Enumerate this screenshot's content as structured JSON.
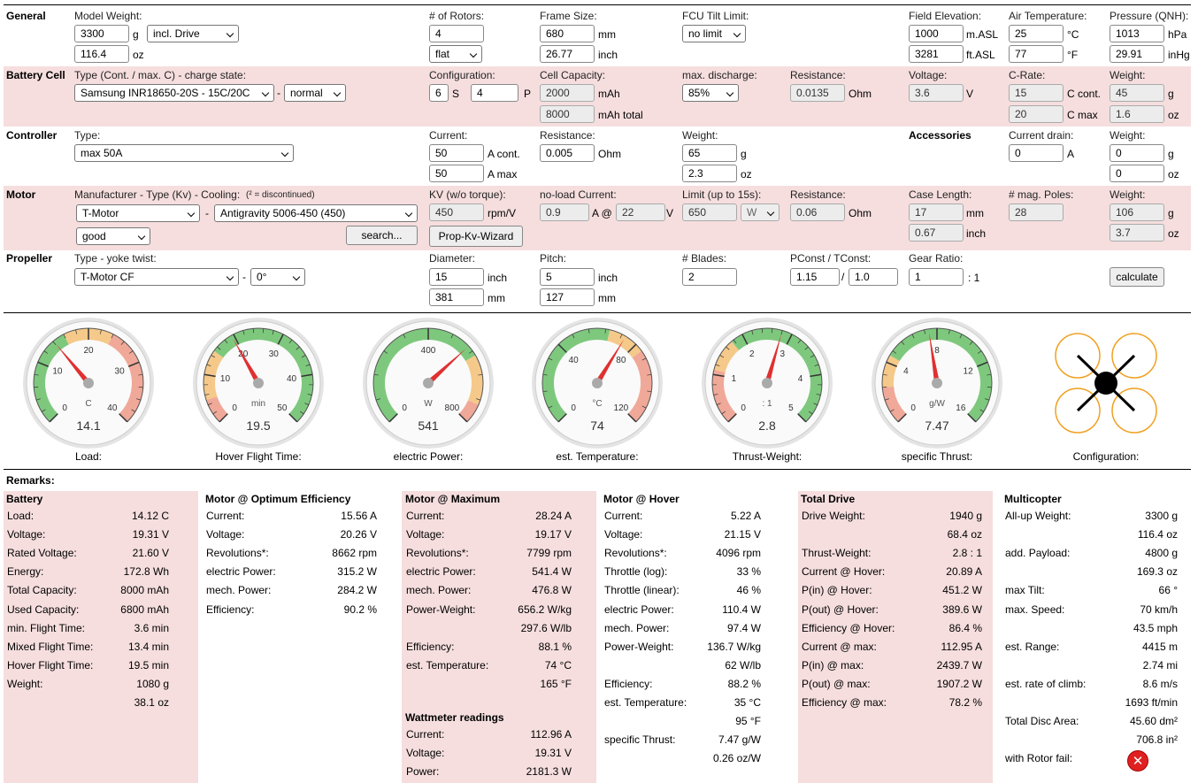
{
  "general": {
    "title": "General",
    "model_weight_label": "Model Weight:",
    "model_weight": "3300",
    "model_weight_unit": "g",
    "drive_option": "incl. Drive",
    "model_weight_oz": "116.4",
    "oz_unit": "oz",
    "rotors_label": "# of Rotors:",
    "rotors": "4",
    "rotor_layout": "flat",
    "frame_label": "Frame Size:",
    "frame_mm": "680",
    "frame_mm_unit": "mm",
    "frame_inch": "26.77",
    "frame_inch_unit": "inch",
    "fcu_label": "FCU Tilt Limit:",
    "fcu_value": "no limit",
    "elev_label": "Field Elevation:",
    "elev_m": "1000",
    "elev_m_unit": "m.ASL",
    "elev_ft": "3281",
    "elev_ft_unit": "ft.ASL",
    "air_label": "Air Temperature:",
    "air_c": "25",
    "air_c_unit": "°C",
    "air_f": "77",
    "air_f_unit": "°F",
    "pressure_label": "Pressure (QNH):",
    "pressure_hpa": "1013",
    "pressure_hpa_unit": "hPa",
    "pressure_inhg": "29.91",
    "pressure_inhg_unit": "inHg"
  },
  "battery": {
    "title": "Battery Cell",
    "type_label": "Type (Cont. / max. C) - charge state:",
    "type_value": "Samsung INR18650-20S - 15C/20C",
    "dash": "-",
    "state_value": "normal",
    "config_label": "Configuration:",
    "s_value": "6",
    "s_unit": "S",
    "p_value": "4",
    "p_unit": "P",
    "cap_label": "Cell Capacity:",
    "cap_value": "2000",
    "cap_unit": "mAh",
    "cap_total": "8000",
    "cap_total_unit": "mAh total",
    "discharge_label": "max. discharge:",
    "discharge_value": "85%",
    "res_label": "Resistance:",
    "res_value": "0.0135",
    "res_unit": "Ohm",
    "volt_label": "Voltage:",
    "volt_value": "3.6",
    "volt_unit": "V",
    "crate_label": "C-Rate:",
    "crate_cont": "15",
    "crate_cont_unit": "C cont.",
    "crate_max": "20",
    "crate_max_unit": "C max",
    "weight_label": "Weight:",
    "weight_g": "45",
    "weight_g_unit": "g",
    "weight_oz": "1.6",
    "weight_oz_unit": "oz"
  },
  "controller": {
    "title": "Controller",
    "type_label": "Type:",
    "type_value": "max 50A",
    "current_label": "Current:",
    "cur_cont": "50",
    "cur_cont_unit": "A cont.",
    "cur_max": "50",
    "cur_max_unit": "A max",
    "res_label": "Resistance:",
    "res_value": "0.005",
    "res_unit": "Ohm",
    "weight_label": "Weight:",
    "weight_g": "65",
    "weight_g_unit": "g",
    "weight_oz": "2.3",
    "weight_oz_unit": "oz",
    "acc_title": "Accessories",
    "drain_label": "Current drain:",
    "drain_value": "0",
    "drain_unit": "A",
    "acc_weight_label": "Weight:",
    "acc_weight_g": "0",
    "acc_weight_g_unit": "g",
    "acc_weight_oz": "0",
    "acc_weight_oz_unit": "oz"
  },
  "motor": {
    "title": "Motor",
    "type_label": "Manufacturer - Type (Kv) - Cooling:",
    "type_note": "(² = discontinued)",
    "manufacturer": "T-Motor",
    "dash": "-",
    "model": "Antigravity 5006-450 (450)",
    "cooling": "good",
    "search": "search...",
    "kv_label": "KV (w/o torque):",
    "kv_value": "450",
    "kv_unit": "rpm/V",
    "wizard": "Prop-Kv-Wizard",
    "noload_label": "no-load Current:",
    "noload_a": "0.9",
    "noload_at": "A @",
    "noload_v": "22",
    "noload_v_unit": "V",
    "limit_label": "Limit (up to 15s):",
    "limit_value": "650",
    "limit_unit": "W",
    "res_label": "Resistance:",
    "res_value": "0.06",
    "res_unit": "Ohm",
    "case_label": "Case Length:",
    "case_mm": "17",
    "case_mm_unit": "mm",
    "case_inch": "0.67",
    "case_inch_unit": "inch",
    "poles_label": "# mag. Poles:",
    "poles_value": "28",
    "weight_label": "Weight:",
    "weight_g": "106",
    "weight_g_unit": "g",
    "weight_oz": "3.7",
    "weight_oz_unit": "oz"
  },
  "propeller": {
    "title": "Propeller",
    "type_label": "Type - yoke twist:",
    "type_value": "T-Motor CF",
    "dash": "-",
    "twist": "0°",
    "dia_label": "Diameter:",
    "dia_inch": "15",
    "dia_inch_unit": "inch",
    "dia_mm": "381",
    "dia_mm_unit": "mm",
    "pitch_label": "Pitch:",
    "pitch_inch": "5",
    "pitch_inch_unit": "inch",
    "pitch_mm": "127",
    "pitch_mm_unit": "mm",
    "blades_label": "# Blades:",
    "blades": "2",
    "pconst_label": "PConst / TConst:",
    "pconst": "1.15",
    "slash": "/",
    "tconst": "1.0",
    "gear_label": "Gear Ratio:",
    "gear": "1",
    "gear_unit": ": 1",
    "calculate": "calculate"
  },
  "gauges": [
    {
      "label": "Load:",
      "value": "14.1",
      "unit": "C",
      "level": 14.1,
      "min": 0,
      "max": 40,
      "ticks": [
        "0",
        "10",
        "20",
        "30",
        "40"
      ],
      "zones": [
        [
          "#7ec87e",
          0,
          0.4
        ],
        [
          "#f5c98a",
          0.4,
          0.6
        ],
        [
          "#f0a898",
          0.6,
          1
        ]
      ]
    },
    {
      "label": "Hover Flight Time:",
      "value": "19.5",
      "unit": "min",
      "level": 19.5,
      "min": 0,
      "max": 50,
      "ticks": [
        "0",
        "10",
        "20",
        "30",
        "40",
        "50"
      ],
      "zones": [
        [
          "#f0a898",
          0,
          0.1
        ],
        [
          "#f5c98a",
          0.1,
          0.3
        ],
        [
          "#7ec87e",
          0.3,
          1
        ]
      ]
    },
    {
      "label": "electric Power:",
      "value": "541",
      "unit": "W",
      "level": 541,
      "min": 0,
      "max": 800,
      "ticks": [
        "0",
        "400",
        "800"
      ],
      "zones": [
        [
          "#7ec87e",
          0,
          0.72
        ],
        [
          "#f5c98a",
          0.72,
          0.92
        ],
        [
          "#f0a898",
          0.92,
          1
        ]
      ]
    },
    {
      "label": "est. Temperature:",
      "value": "74",
      "unit": "°C",
      "level": 74,
      "min": 0,
      "max": 120,
      "ticks": [
        "0",
        "40",
        "80",
        "120"
      ],
      "zones": [
        [
          "#7ec87e",
          0,
          0.55
        ],
        [
          "#f5c98a",
          0.55,
          0.7
        ],
        [
          "#f0a898",
          0.7,
          1
        ]
      ]
    },
    {
      "label": "Thrust-Weight:",
      "value": "2.8",
      "unit": ": 1",
      "level": 2.8,
      "min": 0,
      "max": 5,
      "ticks": [
        "0",
        "1",
        "2",
        "3",
        "4",
        "5"
      ],
      "zones": [
        [
          "#f0a898",
          0,
          0.22
        ],
        [
          "#f5c98a",
          0.22,
          0.35
        ],
        [
          "#7ec87e",
          0.35,
          1
        ]
      ]
    },
    {
      "label": "specific Thrust:",
      "value": "7.47",
      "unit": "g/W",
      "level": 7.47,
      "min": 0,
      "max": 16,
      "ticks": [
        "0",
        "4",
        "8",
        "12",
        "16"
      ],
      "zones": [
        [
          "#f0a898",
          0,
          0.15
        ],
        [
          "#f5c98a",
          0.15,
          0.28
        ],
        [
          "#7ec87e",
          0.28,
          1
        ]
      ]
    }
  ],
  "configuration_label": "Configuration:",
  "remarks": {
    "title": "Remarks:",
    "battery": {
      "title": "Battery",
      "rows": [
        [
          "Load:",
          "14.12 C"
        ],
        [
          "Voltage:",
          "19.31 V"
        ],
        [
          "Rated Voltage:",
          "21.60 V"
        ],
        [
          "Energy:",
          "172.8 Wh"
        ],
        [
          "Total Capacity:",
          "8000 mAh"
        ],
        [
          "Used Capacity:",
          "6800 mAh"
        ],
        [
          "min. Flight Time:",
          "3.6 min"
        ],
        [
          "Mixed Flight Time:",
          "13.4 min"
        ],
        [
          "Hover Flight Time:",
          "19.5 min"
        ],
        [
          "Weight:",
          "1080 g"
        ],
        [
          "",
          "38.1 oz"
        ]
      ]
    },
    "optimum": {
      "title": "Motor @ Optimum Efficiency",
      "rows": [
        [
          "Current:",
          "15.56 A"
        ],
        [
          "Voltage:",
          "20.26 V"
        ],
        [
          "Revolutions*:",
          "8662 rpm"
        ],
        [
          "electric Power:",
          "315.2 W"
        ],
        [
          "mech. Power:",
          "284.2 W"
        ],
        [
          "Efficiency:",
          "90.2 %"
        ]
      ]
    },
    "maximum": {
      "title": "Motor @ Maximum",
      "rows": [
        [
          "Current:",
          "28.24 A"
        ],
        [
          "Voltage:",
          "19.17 V"
        ],
        [
          "Revolutions*:",
          "7799 rpm"
        ],
        [
          "electric Power:",
          "541.4 W"
        ],
        [
          "mech. Power:",
          "476.8 W"
        ],
        [
          "Power-Weight:",
          "656.2 W/kg"
        ],
        [
          "",
          "297.6 W/lb"
        ],
        [
          "Efficiency:",
          "88.1 %"
        ],
        [
          "est. Temperature:",
          "74 °C"
        ],
        [
          "",
          "165 °F"
        ]
      ]
    },
    "wattmeter": {
      "title": "Wattmeter readings",
      "rows": [
        [
          "Current:",
          "112.96 A"
        ],
        [
          "Voltage:",
          "19.31 V"
        ],
        [
          "Power:",
          "2181.3 W"
        ]
      ]
    },
    "hover": {
      "title": "Motor @ Hover",
      "rows": [
        [
          "Current:",
          "5.22 A"
        ],
        [
          "Voltage:",
          "21.15 V"
        ],
        [
          "Revolutions*:",
          "4096 rpm"
        ],
        [
          "Throttle (log):",
          "33 %"
        ],
        [
          "Throttle (linear):",
          "46 %"
        ],
        [
          "electric Power:",
          "110.4 W"
        ],
        [
          "mech. Power:",
          "97.4 W"
        ],
        [
          "Power-Weight:",
          "136.7 W/kg"
        ],
        [
          "",
          "62 W/lb"
        ],
        [
          "Efficiency:",
          "88.2 %"
        ],
        [
          "est. Temperature:",
          "35 °C"
        ],
        [
          "",
          "95 °F"
        ],
        [
          "specific Thrust:",
          "7.47 g/W"
        ],
        [
          "",
          "0.26 oz/W"
        ]
      ]
    },
    "drive": {
      "title": "Total Drive",
      "rows": [
        [
          "Drive Weight:",
          "1940 g"
        ],
        [
          "",
          "68.4 oz"
        ],
        [
          "Thrust-Weight:",
          "2.8 : 1"
        ],
        [
          "Current @ Hover:",
          "20.89 A"
        ],
        [
          "P(in) @ Hover:",
          "451.2 W"
        ],
        [
          "P(out) @ Hover:",
          "389.6 W"
        ],
        [
          "Efficiency @ Hover:",
          "86.4 %"
        ],
        [
          "Current @ max:",
          "112.95 A"
        ],
        [
          "P(in) @ max:",
          "2439.7 W"
        ],
        [
          "P(out) @ max:",
          "1907.2 W"
        ],
        [
          "Efficiency @ max:",
          "78.2 %"
        ]
      ]
    },
    "multicopter": {
      "title": "Multicopter",
      "rows": [
        [
          "All-up Weight:",
          "3300 g"
        ],
        [
          "",
          "116.4 oz"
        ],
        [
          "add. Payload:",
          "4800 g"
        ],
        [
          "",
          "169.3 oz"
        ],
        [
          "max Tilt:",
          "66 °"
        ],
        [
          "max. Speed:",
          "70 km/h"
        ],
        [
          "",
          "43.5 mph"
        ],
        [
          "est. Range:",
          "4415 m"
        ],
        [
          "",
          "2.74 mi"
        ],
        [
          "est. rate of climb:",
          "8.6 m/s"
        ],
        [
          "",
          "1693 ft/min"
        ],
        [
          "Total Disc Area:",
          "45.60 dm²"
        ],
        [
          "",
          "706.8 in²"
        ],
        [
          "with Rotor fail:",
          ""
        ]
      ]
    }
  }
}
